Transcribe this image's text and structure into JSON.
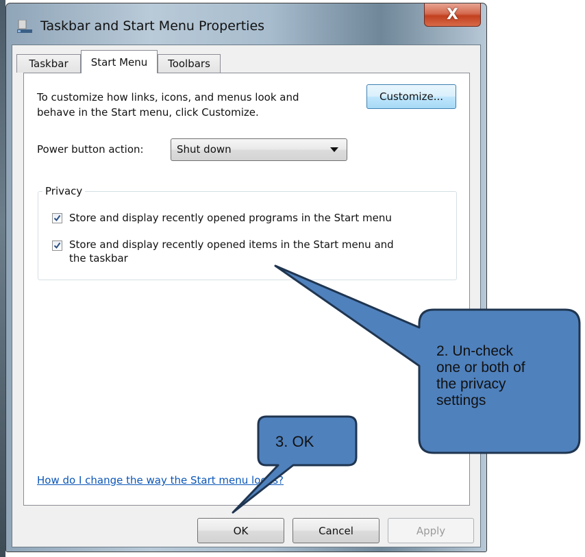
{
  "window": {
    "title": "Taskbar and Start Menu Properties",
    "close_glyph": "X"
  },
  "tabs": [
    {
      "label": "Taskbar",
      "selected": false
    },
    {
      "label": "Start Menu",
      "selected": true
    },
    {
      "label": "Toolbars",
      "selected": false
    }
  ],
  "start_menu": {
    "description_lines": [
      "To customize how links, icons, and menus look and",
      "behave in the Start menu, click Customize."
    ],
    "customize_label": "Customize...",
    "power_label": "Power button action:",
    "power_value": "Shut down",
    "privacy": {
      "title": "Privacy",
      "options": [
        {
          "lines": [
            "Store and display recently opened programs in the Start menu"
          ],
          "checked": true
        },
        {
          "lines": [
            "Store and display recently opened items in the Start menu and",
            "the taskbar"
          ],
          "checked": true
        }
      ]
    },
    "help_link": "How do I change the way the Start menu looks?"
  },
  "buttons": {
    "ok": "OK",
    "cancel": "Cancel",
    "apply": "Apply"
  },
  "callouts": {
    "privacy_lines": [
      "2. Un-check",
      "one or both of",
      "the privacy",
      "settings"
    ],
    "ok": "3. OK",
    "fill": "#4f81bd",
    "stroke": "#1f3550"
  },
  "icons": {
    "app": "taskbar-app-icon",
    "close": "close-icon",
    "checkbox": "checkmark-icon",
    "dropdown": "chevron-down-icon"
  }
}
